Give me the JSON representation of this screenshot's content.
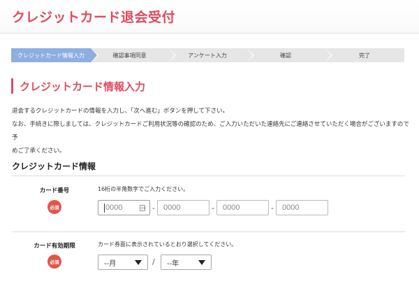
{
  "header": {
    "title": "クレジットカード退会受付"
  },
  "steps": [
    {
      "label": "クレジットカード情報入力",
      "active": true
    },
    {
      "label": "確認事項同意",
      "active": false
    },
    {
      "label": "アンケート入力",
      "active": false
    },
    {
      "label": "確認",
      "active": false
    },
    {
      "label": "完了",
      "active": false
    }
  ],
  "section": {
    "title": "クレジットカード情報入力"
  },
  "intro": {
    "line1": "退会するクレジットカードの情報を入力し、「次へ進む」ボタンを押して下さい。",
    "line2": "なお、手続きに際しましては、クレジットカードご利用状況等の確認のため、ご入力いただいた連絡先にご連絡させていただく場合がございますので予",
    "line3": "めご了承ください。"
  },
  "card_info": {
    "heading": "クレジットカード情報",
    "card_number": {
      "label": "カード番号",
      "required": "必須",
      "hint": "16桁の半角数字でご入力ください。",
      "fields": [
        {
          "placeholder": "0000",
          "value": ""
        },
        {
          "placeholder": "0000",
          "value": ""
        },
        {
          "placeholder": "0000",
          "value": ""
        },
        {
          "placeholder": "0000",
          "value": ""
        }
      ],
      "separator": "-"
    },
    "expiry": {
      "label": "カード有効期限",
      "required": "必須",
      "hint": "カード券面に表示されているとおり選択してください。",
      "month": "--月",
      "year": "--年",
      "separator": "/"
    }
  },
  "colors": {
    "accent": "#e04a5e",
    "active_step": "#8daee0",
    "required_badge": "#e2564a"
  },
  "icons": {
    "keypad": "keypad-icon",
    "dropdown": "chevron-down-icon"
  }
}
